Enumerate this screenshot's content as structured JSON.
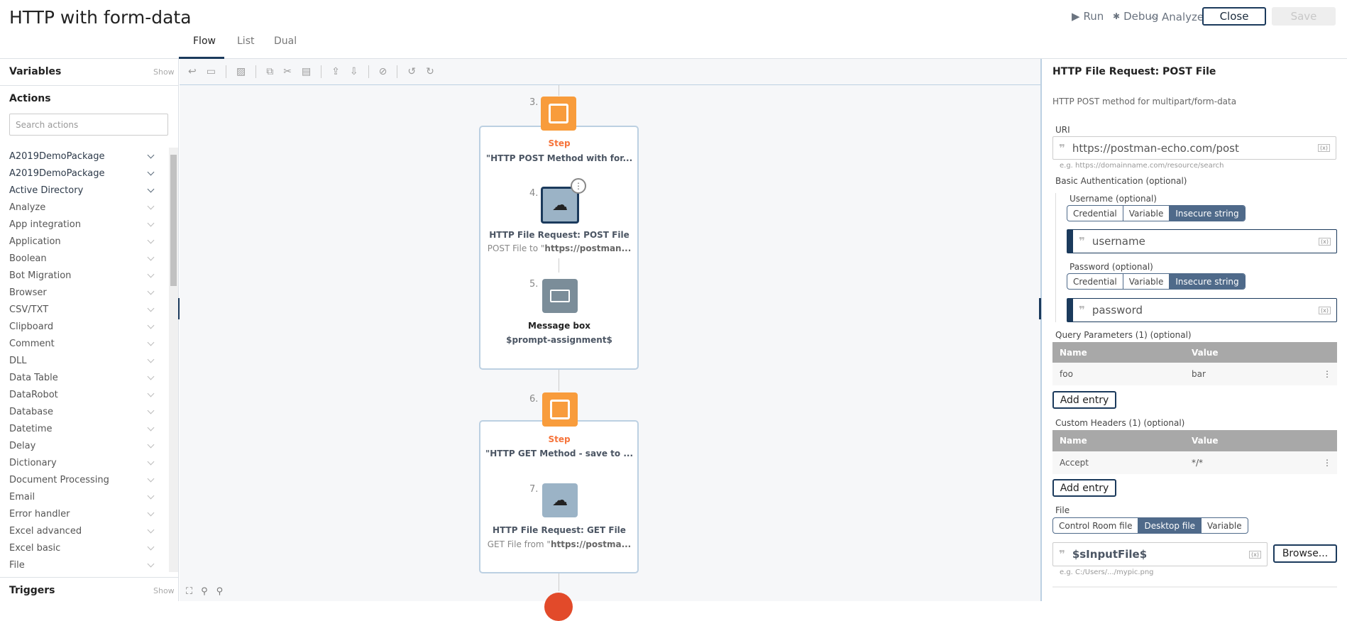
{
  "header": {
    "title": "HTTP with form-data",
    "run": "Run",
    "debug": "Debug",
    "analyze": "Analyze",
    "close": "Close",
    "save": "Save"
  },
  "tabs": [
    "Flow",
    "List",
    "Dual"
  ],
  "sidebar": {
    "variables": "Variables",
    "show": "Show",
    "actions": "Actions",
    "search_placeholder": "Search actions",
    "triggers": "Triggers",
    "items": [
      "A2019DemoPackage",
      "A2019DemoPackage",
      "Active Directory",
      "Analyze",
      "App integration",
      "Application",
      "Boolean",
      "Bot Migration",
      "Browser",
      "CSV/TXT",
      "Clipboard",
      "Comment",
      "DLL",
      "Data Table",
      "DataRobot",
      "Database",
      "Datetime",
      "Delay",
      "Dictionary",
      "Document Processing",
      "Email",
      "Error handler",
      "Excel advanced",
      "Excel basic",
      "File"
    ]
  },
  "flow": {
    "s3": {
      "num": "3.",
      "type": "Step",
      "title": "\"HTTP POST Method with for..."
    },
    "s4": {
      "num": "4.",
      "title": "HTTP File Request: POST File",
      "desc_prefix": "POST File to \"",
      "desc_bold": "https://postman..."
    },
    "s5": {
      "num": "5.",
      "title": "Message box",
      "desc": "$prompt-assignment$"
    },
    "s6": {
      "num": "6.",
      "type": "Step",
      "title": "\"HTTP GET Method - save to ..."
    },
    "s7": {
      "num": "7.",
      "title": "HTTP File Request: GET File",
      "desc_prefix": "GET File from \"",
      "desc_bold": "https://postma..."
    }
  },
  "panel": {
    "title": "HTTP File Request: POST File",
    "description": "HTTP POST method for multipart/form-data",
    "uri_label": "URI",
    "uri_value": "https://postman-echo.com/post",
    "uri_hint": "e.g. https://domainname.com/resource/search",
    "basic_auth": "Basic Authentication (optional)",
    "username_label": "Username (optional)",
    "password_label": "Password (optional)",
    "cred_options": [
      "Credential",
      "Variable",
      "Insecure string"
    ],
    "username_value": "username",
    "password_value": "password",
    "query_label": "Query Parameters (1) (optional)",
    "col_name": "Name",
    "col_value": "Value",
    "query_rows": [
      {
        "name": "foo",
        "value": "bar"
      }
    ],
    "add_entry": "Add entry",
    "headers_label": "Custom Headers (1) (optional)",
    "header_rows": [
      {
        "name": "Accept",
        "value": "*/*"
      }
    ],
    "file_label": "File",
    "file_options": [
      "Control Room file",
      "Desktop file",
      "Variable"
    ],
    "file_value": "$sInputFile$",
    "browse": "Browse...",
    "file_hint": "e.g. C:/Users/.../mypic.png"
  }
}
